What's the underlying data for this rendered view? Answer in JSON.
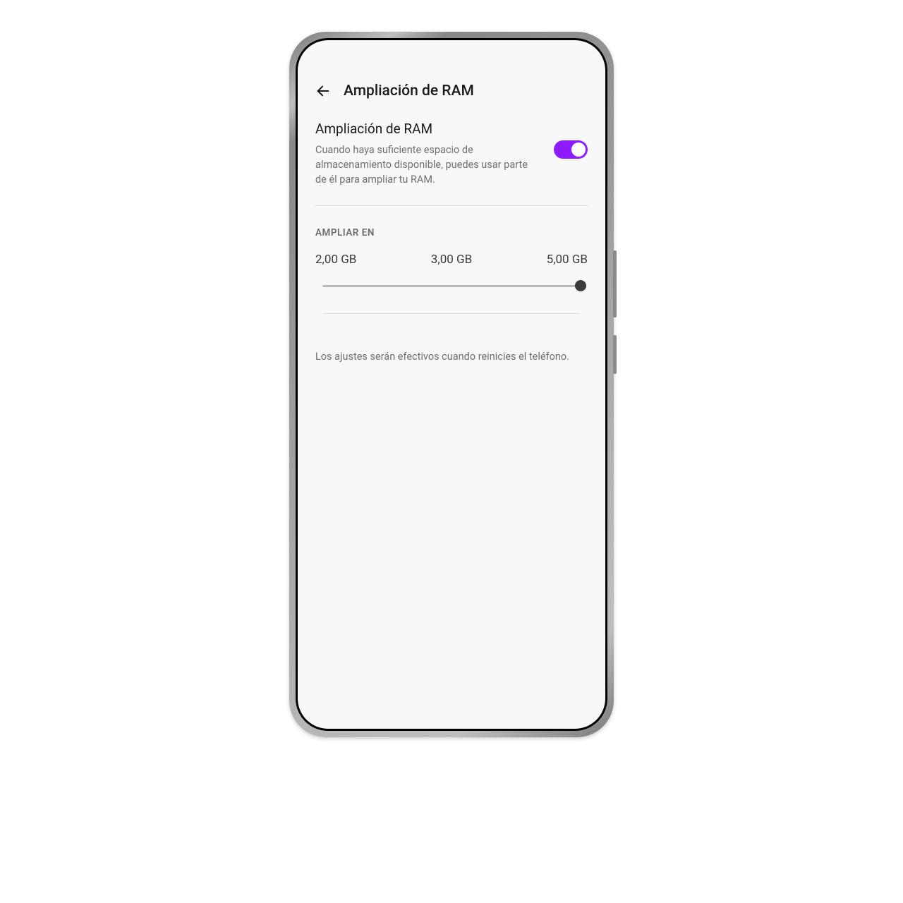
{
  "header": {
    "title": "Ampliación de RAM"
  },
  "setting": {
    "title": "Ampliación de RAM",
    "description": "Cuando haya suficiente espacio de almacenamiento disponible, puedes usar parte de él para ampliar tu RAM.",
    "toggle_on": true,
    "accent_color": "#8c1cff"
  },
  "expand_section": {
    "label": "AMPLIAR EN",
    "options": [
      "2,00 GB",
      "3,00 GB",
      "5,00 GB"
    ],
    "selected_index": 2
  },
  "footer_note": "Los ajustes serán efectivos cuando reinicies el teléfono."
}
